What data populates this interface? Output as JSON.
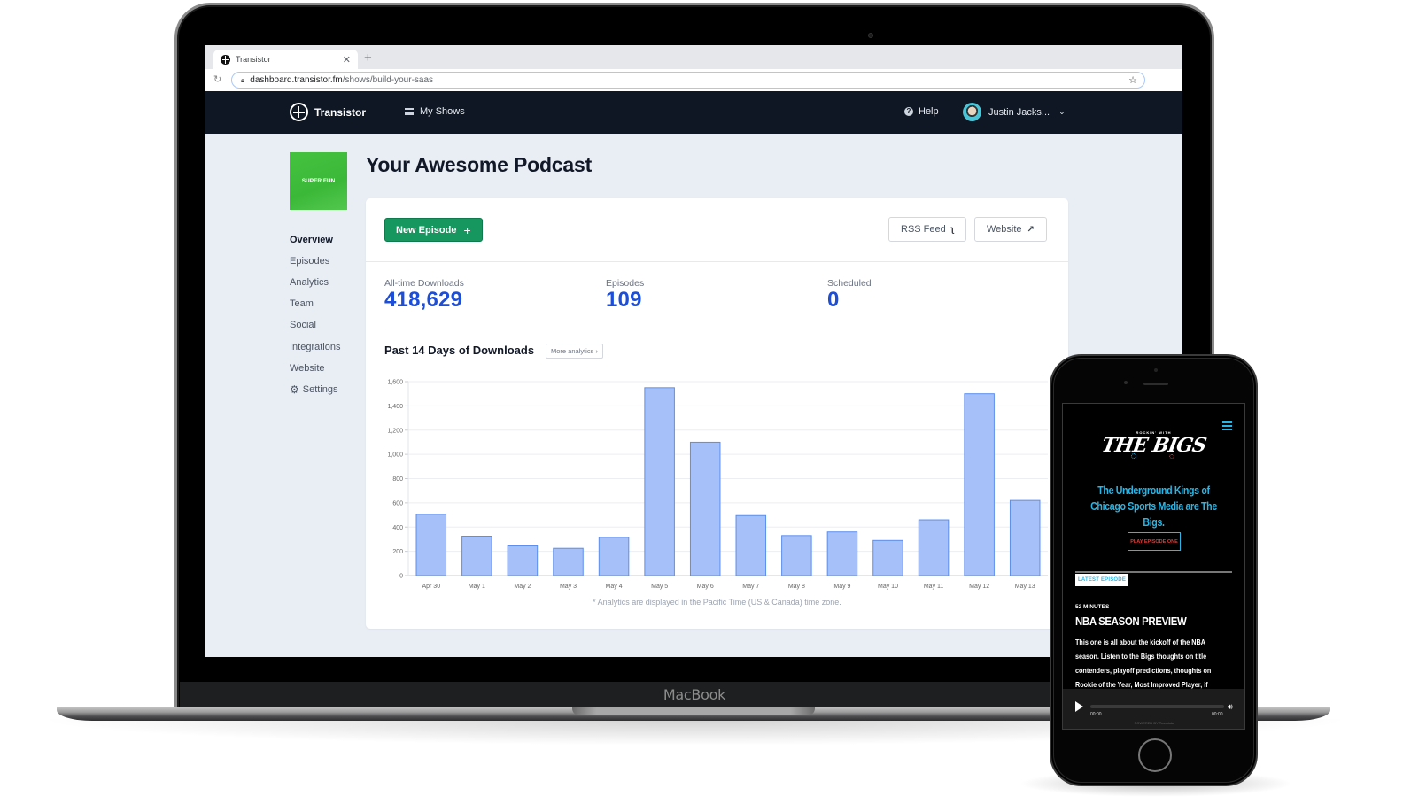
{
  "device_labels": {
    "laptop": "MacBook"
  },
  "browser": {
    "tab_title": "Transistor",
    "url_host": "dashboard.transistor.fm",
    "url_path": "/shows/build-your-saas"
  },
  "nav": {
    "brand": "Transistor",
    "my_shows": "My Shows",
    "help": "Help",
    "user_name": "Justin Jacks..."
  },
  "show": {
    "cover_text": "SUPER FUN",
    "title": "Your Awesome Podcast"
  },
  "sidebar": {
    "items": [
      {
        "label": "Overview",
        "active": true
      },
      {
        "label": "Episodes"
      },
      {
        "label": "Analytics"
      },
      {
        "label": "Team"
      },
      {
        "label": "Social"
      },
      {
        "label": "Integrations"
      },
      {
        "label": "Website"
      },
      {
        "label": "Settings",
        "icon": "gear-icon"
      }
    ]
  },
  "card": {
    "new_episode": "New Episode",
    "rss_feed": "RSS Feed",
    "website": "Website",
    "stats": [
      {
        "label": "All-time Downloads",
        "value": "418,629"
      },
      {
        "label": "Episodes",
        "value": "109"
      },
      {
        "label": "Scheduled",
        "value": "0"
      }
    ],
    "chart_title": "Past 14 Days of Downloads",
    "more_analytics": "More analytics",
    "footnote": "* Analytics are displayed in the Pacific Time (US & Canada) time zone."
  },
  "chart_data": {
    "type": "bar",
    "title": "Past 14 Days of Downloads",
    "xlabel": "",
    "ylabel": "",
    "categories": [
      "Apr 30",
      "May 1",
      "May 2",
      "May 3",
      "May 4",
      "May 5",
      "May 6",
      "May 7",
      "May 8",
      "May 9",
      "May 10",
      "May 11",
      "May 12",
      "May 13"
    ],
    "values": [
      505,
      325,
      245,
      225,
      315,
      1550,
      1100,
      495,
      330,
      360,
      290,
      460,
      1500,
      620
    ],
    "ylim": [
      0,
      1600
    ],
    "yticks": [
      0,
      200,
      400,
      600,
      800,
      1000,
      1200,
      1400,
      1600
    ],
    "ytick_labels": [
      "0",
      "200",
      "400",
      "600",
      "800",
      "1,000",
      "1,200",
      "1,400",
      "1,600"
    ],
    "grid": true,
    "colors": {
      "fill": "#a6c1fa",
      "stroke": "#5b8def"
    }
  },
  "phone": {
    "logo_small": "ROCKIN' WITH",
    "logo_big": "THE BIGS",
    "tagline": "The Underground Kings of Chicago Sports Media are The Bigs.",
    "play_episode": "PLAY EPISODE ONE",
    "latest_badge": "LATEST EPISODE",
    "duration": "52 MINUTES",
    "episode_title": "NBA SEASON PREVIEW",
    "episode_desc": "This one is all about the kickoff of the NBA season. Listen to the Bigs thoughts on title contenders, playoff predictions, thoughts on Rookie of the Year, Most Improved Player, if",
    "time_elapsed": "00:00",
    "time_total": "00:00",
    "powered_by": "POWERED BY  Transistor",
    "accent": "#29b6e6",
    "cta_color": "#e53935"
  }
}
